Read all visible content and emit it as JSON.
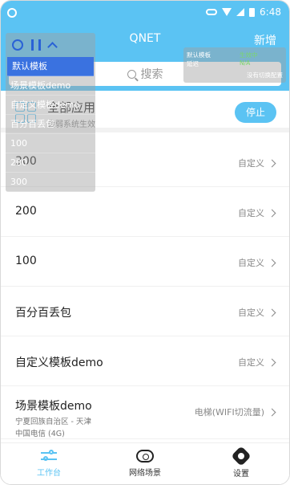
{
  "status_bar": {
    "time": "6:48"
  },
  "header": {
    "title": "QNET",
    "add_label": "新增"
  },
  "search": {
    "placeholder": "搜索"
  },
  "all_apps": {
    "title": "全部应用",
    "subtitle": "会弱系统生效",
    "stop_label": "停止"
  },
  "list": [
    {
      "name": "300",
      "tag": "自定义"
    },
    {
      "name": "200",
      "tag": "自定义"
    },
    {
      "name": "100",
      "tag": "自定义"
    },
    {
      "name": "百分百丢包",
      "tag": "自定义"
    },
    {
      "name": "自定义模板demo",
      "tag": "自定义"
    },
    {
      "name": "场景模板demo",
      "tag": "电梯(WIFI切流量)",
      "sub1": "宁夏回族自治区 - 天津",
      "sub2": "中国电信 (4G)"
    }
  ],
  "bottom_nav": [
    {
      "label": "工作台",
      "icon": "workbench-icon",
      "active": true
    },
    {
      "label": "网络场景",
      "icon": "cloud-icon",
      "active": false
    },
    {
      "label": "设置",
      "icon": "gear-icon",
      "active": false
    }
  ],
  "overlay_dropdown": {
    "items": [
      "默认模板",
      "场景模板demo",
      "自定义模板demo",
      "百分百丢包",
      "100",
      "200",
      "300"
    ],
    "selected": "默认模板"
  },
  "overlay_info": {
    "row1_label": "默认模板",
    "row1_value": "生效中",
    "row2_label": "延迟",
    "row2_value": "N/A",
    "link": "没有切换配置"
  },
  "colors": {
    "accent": "#5bc3f3",
    "selected": "#3a72e0"
  }
}
